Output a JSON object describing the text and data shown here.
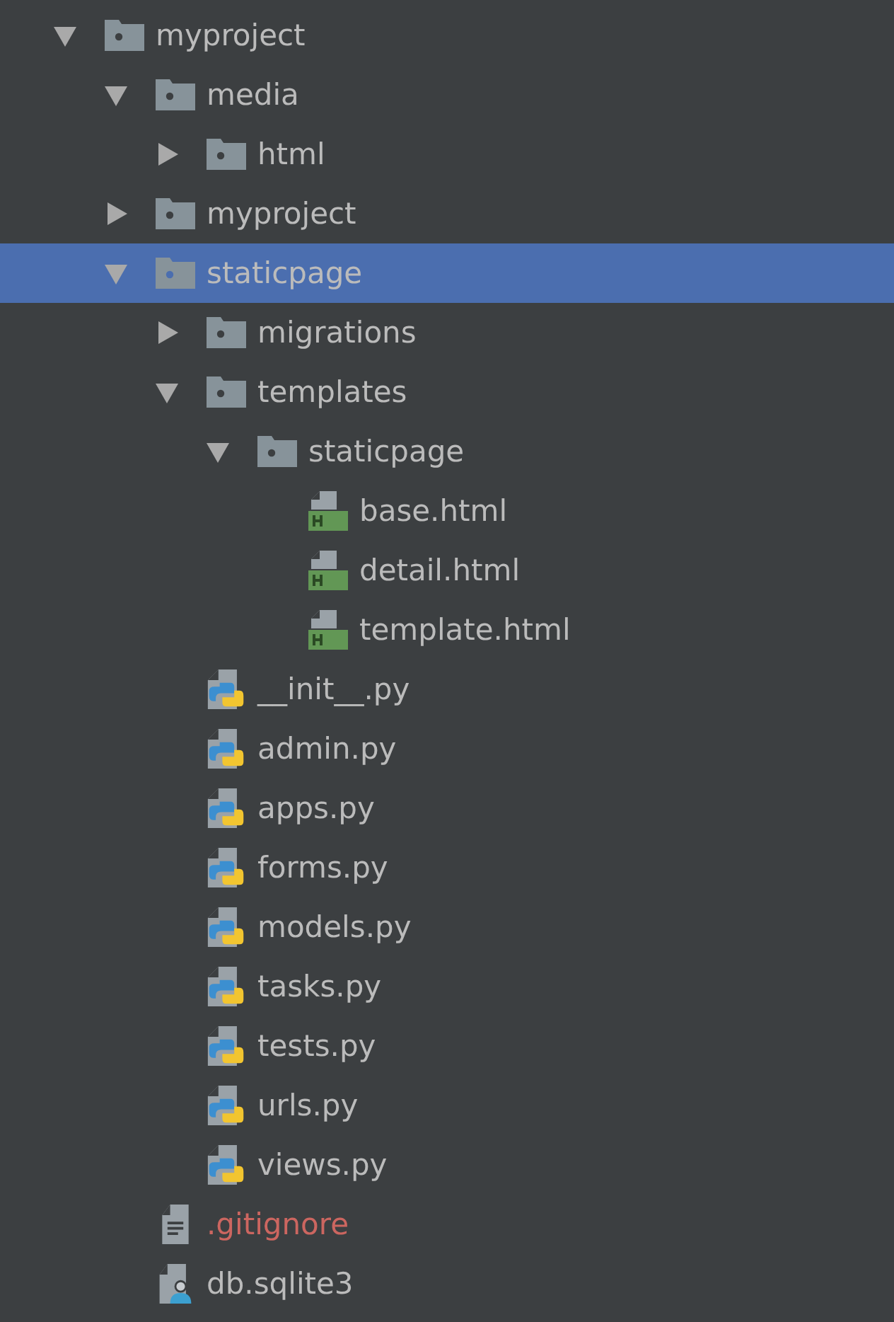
{
  "tree": [
    {
      "name": "myproject",
      "kind": "folder",
      "expanded": true,
      "selected": false,
      "ignored": false,
      "children": [
        {
          "name": "media",
          "kind": "folder",
          "expanded": true,
          "selected": false,
          "ignored": false,
          "children": [
            {
              "name": "html",
              "kind": "folder",
              "expanded": false,
              "selected": false,
              "ignored": false
            }
          ]
        },
        {
          "name": "myproject",
          "kind": "folder",
          "expanded": false,
          "selected": false,
          "ignored": false
        },
        {
          "name": "staticpage",
          "kind": "folder",
          "expanded": true,
          "selected": true,
          "ignored": false,
          "children": [
            {
              "name": "migrations",
              "kind": "folder",
              "expanded": false,
              "selected": false,
              "ignored": false
            },
            {
              "name": "templates",
              "kind": "folder",
              "expanded": true,
              "selected": false,
              "ignored": false,
              "children": [
                {
                  "name": "staticpage",
                  "kind": "folder",
                  "expanded": true,
                  "selected": false,
                  "ignored": false,
                  "children": [
                    {
                      "name": "base.html",
                      "kind": "html",
                      "selected": false,
                      "ignored": false
                    },
                    {
                      "name": "detail.html",
                      "kind": "html",
                      "selected": false,
                      "ignored": false
                    },
                    {
                      "name": "template.html",
                      "kind": "html",
                      "selected": false,
                      "ignored": false
                    }
                  ]
                }
              ]
            },
            {
              "name": "__init__.py",
              "kind": "python",
              "selected": false,
              "ignored": false
            },
            {
              "name": "admin.py",
              "kind": "python",
              "selected": false,
              "ignored": false
            },
            {
              "name": "apps.py",
              "kind": "python",
              "selected": false,
              "ignored": false
            },
            {
              "name": "forms.py",
              "kind": "python",
              "selected": false,
              "ignored": false
            },
            {
              "name": "models.py",
              "kind": "python",
              "selected": false,
              "ignored": false
            },
            {
              "name": "tasks.py",
              "kind": "python",
              "selected": false,
              "ignored": false
            },
            {
              "name": "tests.py",
              "kind": "python",
              "selected": false,
              "ignored": false
            },
            {
              "name": "urls.py",
              "kind": "python",
              "selected": false,
              "ignored": false
            },
            {
              "name": "views.py",
              "kind": "python",
              "selected": false,
              "ignored": false
            }
          ]
        },
        {
          "name": ".gitignore",
          "kind": "text",
          "selected": false,
          "ignored": true
        },
        {
          "name": "db.sqlite3",
          "kind": "db",
          "selected": false,
          "ignored": false
        }
      ]
    }
  ]
}
